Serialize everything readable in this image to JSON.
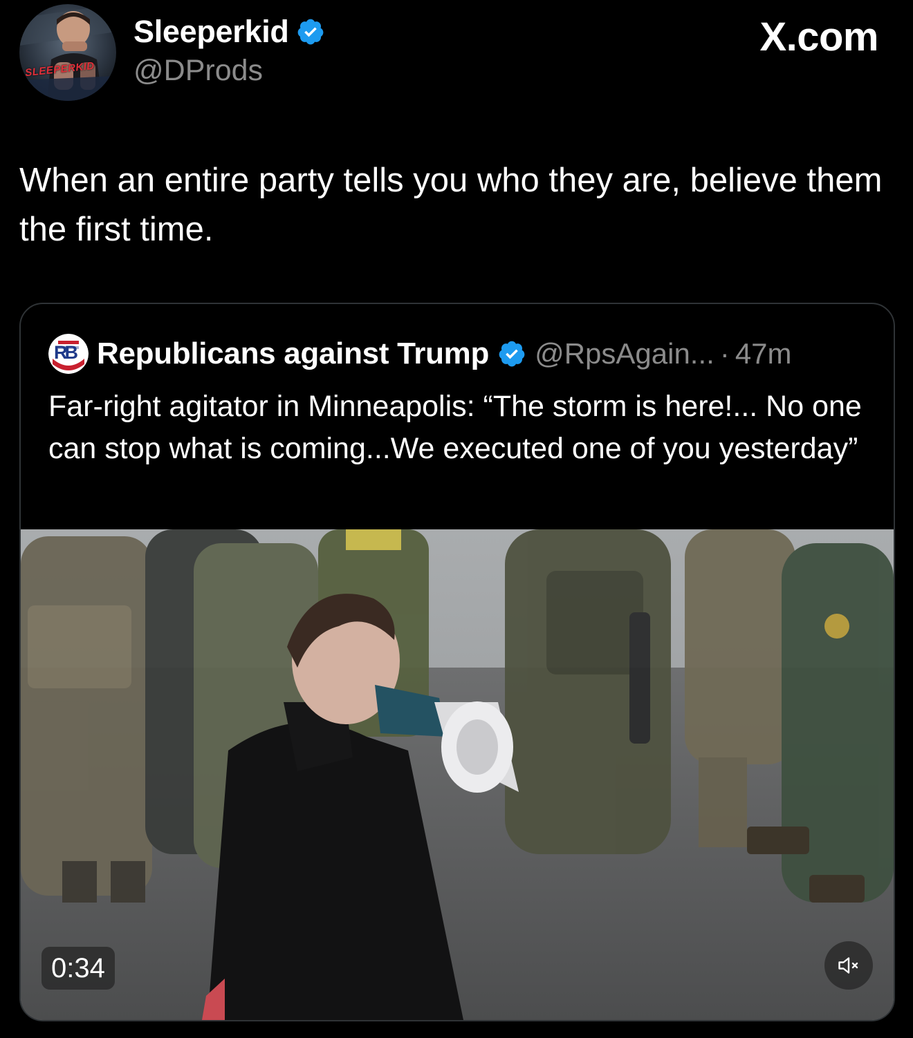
{
  "author": {
    "display_name": "Sleeperkid",
    "handle": "@DProds",
    "avatar_label": "SLEEPERKID",
    "verified_icon": "verified-badge-icon"
  },
  "site_mark": "X.com",
  "tweet_text": "When an entire party tells you who they are, believe them the first time.",
  "quoted_tweet": {
    "display_name": "Republicans against Trump",
    "handle": "@RpsAgain...",
    "separator": "·",
    "time": "47m",
    "avatar_label": "RB",
    "text": "Far-right agitator in Minneapolis: “The storm is here!... No one can stop what is coming...We executed one of you yesterday”"
  },
  "video": {
    "duration": "0:34",
    "mute_icon": "speaker-muted-icon"
  },
  "colors": {
    "background": "#000000",
    "text_primary": "#ffffff",
    "text_secondary": "#8b8b8b",
    "verified_blue": "#1d9bf0",
    "card_border": "#2f3336"
  }
}
